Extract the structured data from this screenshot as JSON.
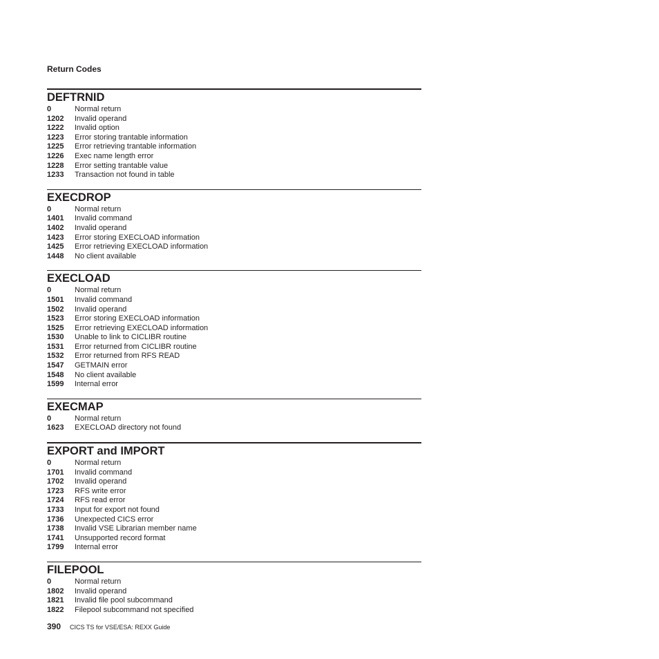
{
  "running_head": "Return Codes",
  "sections": [
    {
      "title": "DEFTRNID",
      "rows": [
        {
          "code": "0",
          "desc": "Normal return"
        },
        {
          "code": "1202",
          "desc": "Invalid operand"
        },
        {
          "code": "1222",
          "desc": "Invalid option"
        },
        {
          "code": "1223",
          "desc": "Error storing trantable information"
        },
        {
          "code": "1225",
          "desc": "Error retrieving trantable information"
        },
        {
          "code": "1226",
          "desc": "Exec name length error"
        },
        {
          "code": "1228",
          "desc": "Error setting trantable value"
        },
        {
          "code": "1233",
          "desc": "Transaction not found in table"
        }
      ]
    },
    {
      "title": "EXECDROP",
      "rows": [
        {
          "code": "0",
          "desc": "Normal return"
        },
        {
          "code": "1401",
          "desc": "Invalid command"
        },
        {
          "code": "1402",
          "desc": "Invalid operand"
        },
        {
          "code": "1423",
          "desc": "Error storing EXECLOAD information"
        },
        {
          "code": "1425",
          "desc": "Error retrieving EXECLOAD information"
        },
        {
          "code": "1448",
          "desc": "No client available"
        }
      ]
    },
    {
      "title": "EXECLOAD",
      "rows": [
        {
          "code": "0",
          "desc": "Normal return"
        },
        {
          "code": "1501",
          "desc": "Invalid command"
        },
        {
          "code": "1502",
          "desc": "Invalid operand"
        },
        {
          "code": "1523",
          "desc": "Error storing EXECLOAD information"
        },
        {
          "code": "1525",
          "desc": "Error retrieving EXECLOAD information"
        },
        {
          "code": "1530",
          "desc": "Unable to link to CICLIBR routine"
        },
        {
          "code": "1531",
          "desc": "Error returned from CICLIBR routine"
        },
        {
          "code": "1532",
          "desc": "Error returned from RFS READ"
        },
        {
          "code": "1547",
          "desc": "GETMAIN error"
        },
        {
          "code": "1548",
          "desc": "No client available"
        },
        {
          "code": "1599",
          "desc": "Internal error"
        }
      ]
    },
    {
      "title": "EXECMAP",
      "rows": [
        {
          "code": "0",
          "desc": "Normal return"
        },
        {
          "code": "1623",
          "desc": "EXECLOAD directory not found"
        }
      ]
    },
    {
      "title": "EXPORT and IMPORT",
      "rows": [
        {
          "code": "0",
          "desc": "Normal return"
        },
        {
          "code": "1701",
          "desc": "Invalid command"
        },
        {
          "code": "1702",
          "desc": "Invalid operand"
        },
        {
          "code": "1723",
          "desc": "RFS write error"
        },
        {
          "code": "1724",
          "desc": "RFS read error"
        },
        {
          "code": "1733",
          "desc": "Input for export not found"
        },
        {
          "code": "1736",
          "desc": "Unexpected CICS error"
        },
        {
          "code": "1738",
          "desc": "Invalid VSE Librarian member name"
        },
        {
          "code": "1741",
          "desc": "Unsupported record format"
        },
        {
          "code": "1799",
          "desc": "Internal error"
        }
      ]
    },
    {
      "title": "FILEPOOL",
      "rows": [
        {
          "code": "0",
          "desc": "Normal return"
        },
        {
          "code": "1802",
          "desc": "Invalid operand"
        },
        {
          "code": "1821",
          "desc": "Invalid file pool subcommand"
        },
        {
          "code": "1822",
          "desc": "Filepool subcommand not specified"
        }
      ]
    }
  ],
  "footer": {
    "page_number": "390",
    "book_title": "CICS TS for VSE/ESA:  REXX Guide"
  }
}
